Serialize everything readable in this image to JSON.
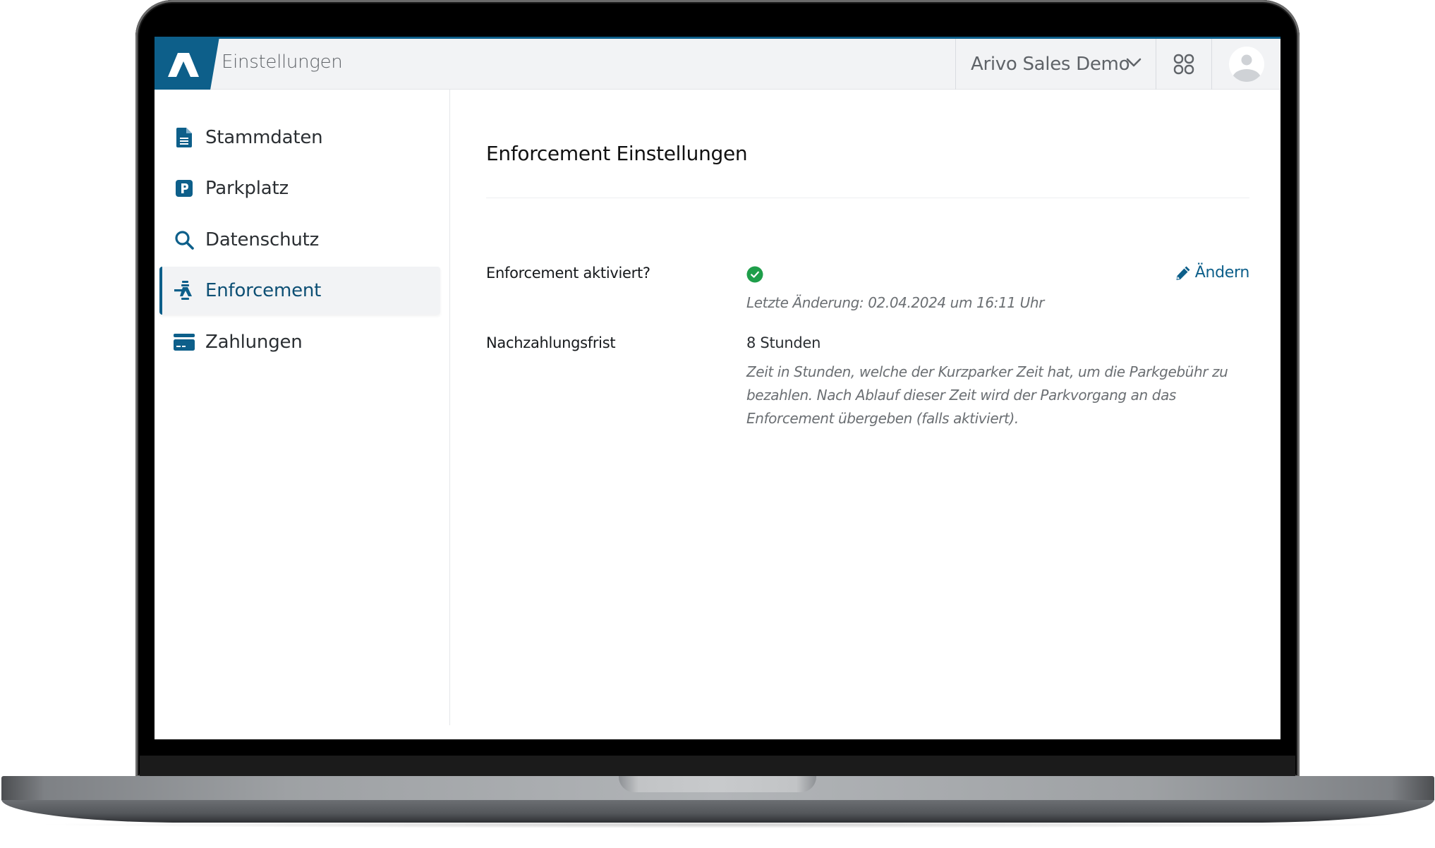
{
  "header": {
    "app_title": "Einstellungen",
    "organization": "Arivo Sales Demo",
    "apps_icon": "grid-icon",
    "avatar_icon": "user-avatar-icon",
    "brand_color": "#0d5f8a"
  },
  "sidebar": {
    "items": [
      {
        "label": "Stammdaten",
        "icon": "document-icon",
        "active": false
      },
      {
        "label": "Parkplatz",
        "icon": "parking-icon",
        "active": false
      },
      {
        "label": "Datenschutz",
        "icon": "search-icon",
        "active": false
      },
      {
        "label": "Enforcement",
        "icon": "enforcement-officer-icon",
        "active": true
      },
      {
        "label": "Zahlungen",
        "icon": "credit-card-icon",
        "active": false
      }
    ]
  },
  "main": {
    "title": "Enforcement Einstellungen",
    "edit_label": "Ändern",
    "rows": [
      {
        "label": "Enforcement aktiviert?",
        "value_icon": "check-circle-icon",
        "value_state": "aktiviert",
        "hint": "Letzte Änderung: 02.04.2024 um 16:11 Uhr"
      },
      {
        "label": "Nachzahlungsfrist",
        "value": "8 Stunden",
        "hint_lines": [
          "Zeit in Stunden, welche der Kurzparker Zeit hat, um die Parkgebühr zu",
          "bezahlen. Nach Ablauf dieser Zeit wird der Parkvorgang an das",
          "Enforcement übergeben (falls aktiviert)."
        ]
      }
    ],
    "success_color": "#1e9e4a"
  }
}
